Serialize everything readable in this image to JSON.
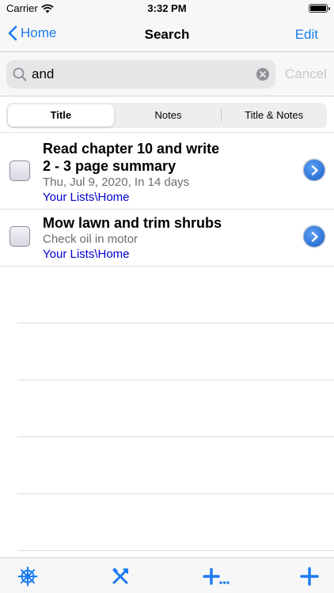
{
  "status_bar": {
    "carrier": "Carrier",
    "time": "3:32 PM"
  },
  "nav": {
    "back_label": "Home",
    "title": "Search",
    "edit_label": "Edit"
  },
  "search": {
    "query": "and",
    "cancel_label": "Cancel"
  },
  "segments": [
    {
      "label": "Title",
      "selected": true
    },
    {
      "label": "Notes",
      "selected": false
    },
    {
      "label": "Title & Notes",
      "selected": false
    }
  ],
  "items": [
    {
      "title_line1": "Read chapter 10 and write",
      "title_line2": "2 - 3 page summary",
      "notes": "Thu, Jul 9, 2020, In 14 days",
      "path": "Your Lists\\Home",
      "checked": false
    },
    {
      "title_line1": "Mow lawn and trim shrubs",
      "notes": "Check oil in motor",
      "path": "Your Lists\\Home",
      "checked": false
    }
  ],
  "toolbar": {
    "icons": [
      "ships-wheel-icon",
      "tools-icon",
      "add-more-icon",
      "add-icon"
    ]
  },
  "colors": {
    "accent": "#1a7bf0",
    "path_link": "#0000cc",
    "placeholder": "#c7c7cc"
  }
}
